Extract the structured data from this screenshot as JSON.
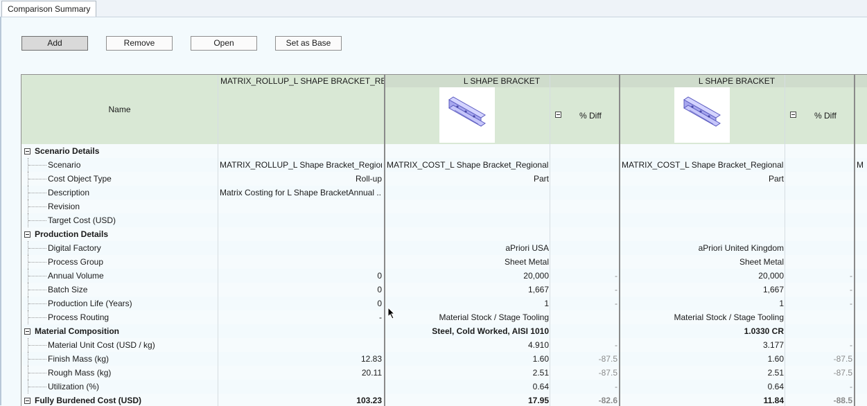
{
  "tab": {
    "label": "Comparison Summary"
  },
  "toolbar": {
    "add": "Add",
    "remove": "Remove",
    "open": "Open",
    "set_as_base": "Set as Base"
  },
  "columns": {
    "name_header": "Name",
    "rollup_header": "MATRIX_ROLLUP_L SHAPE BRACKET_REGI...",
    "comp1_header": "L SHAPE BRACKET",
    "comp2_header": "L SHAPE BRACKET",
    "pct_diff": "% Diff",
    "thumbnail_icon": "bracket-part-thumbnail"
  },
  "rows": [
    {
      "type": "section",
      "name": "Scenario Details",
      "v0": "",
      "v1": "",
      "d1": "",
      "v2": "",
      "d2": ""
    },
    {
      "type": "item",
      "name": "Scenario",
      "v0": "MATRIX_ROLLUP_L Shape Bracket_Region...",
      "v1": "MATRIX_COST_L Shape Bracket_Regional ...",
      "d1": "",
      "v2": "MATRIX_COST_L Shape Bracket_Regional ...",
      "d2": "",
      "v3": "M",
      "align": "left"
    },
    {
      "type": "item",
      "name": "Cost Object Type",
      "v0": "Roll-up",
      "v1": "Part",
      "d1": "",
      "v2": "Part",
      "d2": ""
    },
    {
      "type": "item",
      "name": "Description",
      "v0": "Matrix Costing for L Shape BracketAnnual ...",
      "v1": "",
      "d1": "",
      "v2": "",
      "d2": "",
      "align": "left"
    },
    {
      "type": "item",
      "name": "Revision",
      "v0": "",
      "v1": "",
      "d1": "",
      "v2": "",
      "d2": ""
    },
    {
      "type": "item",
      "name": "Target Cost (USD)",
      "v0": "",
      "v1": "",
      "d1": "",
      "v2": "",
      "d2": ""
    },
    {
      "type": "section",
      "name": "Production Details",
      "v0": "",
      "v1": "",
      "d1": "",
      "v2": "",
      "d2": ""
    },
    {
      "type": "item",
      "name": "Digital Factory",
      "v0": "",
      "v1": "aPriori USA",
      "d1": "",
      "v2": "aPriori United Kingdom",
      "d2": ""
    },
    {
      "type": "item",
      "name": "Process Group",
      "v0": "",
      "v1": "Sheet Metal",
      "d1": "",
      "v2": "Sheet Metal",
      "d2": ""
    },
    {
      "type": "item",
      "name": "Annual Volume",
      "v0": "0",
      "v1": "20,000",
      "d1": "-",
      "v2": "20,000",
      "d2": "-"
    },
    {
      "type": "item",
      "name": "Batch Size",
      "v0": "0",
      "v1": "1,667",
      "d1": "-",
      "v2": "1,667",
      "d2": "-"
    },
    {
      "type": "item",
      "name": "Production Life (Years)",
      "v0": "0",
      "v1": "1",
      "d1": "-",
      "v2": "1",
      "d2": "-"
    },
    {
      "type": "item",
      "name": "Process Routing",
      "v0": "-",
      "v1": "Material Stock / Stage Tooling",
      "d1": "",
      "v2": "Material Stock / Stage Tooling",
      "d2": ""
    },
    {
      "type": "section",
      "name": "Material Composition",
      "v0": "",
      "v1": "Steel, Cold Worked, AISI 1010",
      "d1": "",
      "v2": "1.0330 CR",
      "d2": "",
      "boldvals": true
    },
    {
      "type": "item",
      "name": "Material Unit Cost (USD / kg)",
      "v0": "",
      "v1": "4.910",
      "d1": "-",
      "v2": "3.177",
      "d2": "-"
    },
    {
      "type": "item",
      "name": "Finish Mass (kg)",
      "v0": "12.83",
      "v1": "1.60",
      "d1": "-87.5",
      "v2": "1.60",
      "d2": "-87.5"
    },
    {
      "type": "item",
      "name": "Rough Mass (kg)",
      "v0": "20.11",
      "v1": "2.51",
      "d1": "-87.5",
      "v2": "2.51",
      "d2": "-87.5"
    },
    {
      "type": "item",
      "name": "Utilization (%)",
      "v0": "",
      "v1": "0.64",
      "d1": "-",
      "v2": "0.64",
      "d2": "-"
    },
    {
      "type": "section",
      "name": "Fully Burdened Cost (USD)",
      "v0": "103.23",
      "v1": "17.95",
      "d1": "-82.6",
      "v2": "11.84",
      "d2": "-88.5",
      "boldvals": true
    }
  ]
}
